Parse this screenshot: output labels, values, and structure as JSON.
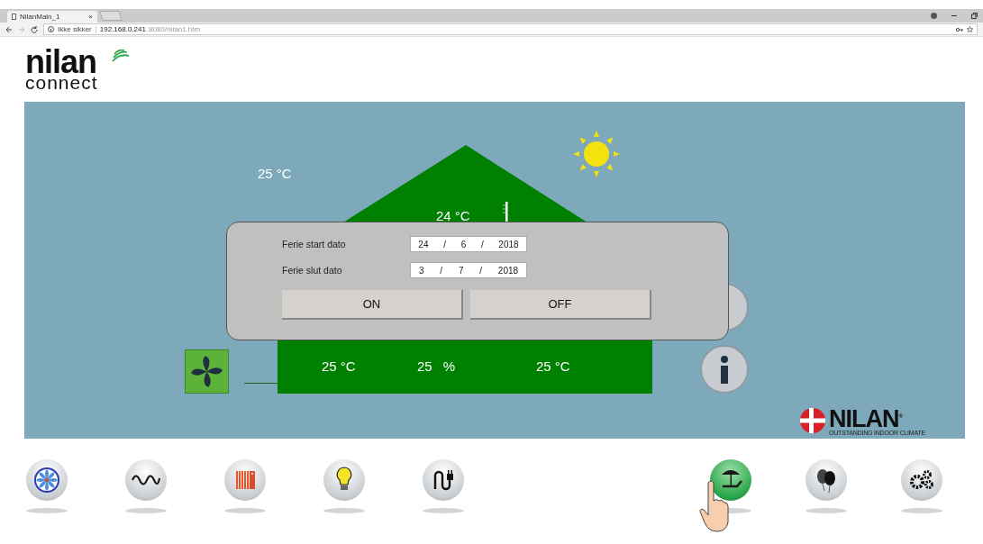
{
  "browser": {
    "tab_title": "NilanMain_1",
    "tab_close": "×",
    "security_label": "Ikke sikker",
    "url_host": "192.168.0.241",
    "url_rest": ":8080/nilan1.htm"
  },
  "logo": {
    "name": "nilan",
    "subtitle": "connect"
  },
  "house": {
    "outdoor_temp": "25 °C",
    "indoor_temp": "24 °C",
    "readings": [
      {
        "kind": "temp",
        "text": "25 °C"
      },
      {
        "kind": "humidity",
        "value": "25",
        "unit": "%"
      },
      {
        "kind": "temp",
        "text": "25 °C"
      }
    ]
  },
  "dialog": {
    "rows": [
      {
        "label": "Ferie start dato",
        "parts": [
          "24",
          "/",
          "6",
          "/",
          "2018"
        ]
      },
      {
        "label": "Ferie slut dato",
        "parts": [
          "3",
          "/",
          "7",
          "/",
          "2018"
        ]
      }
    ],
    "buttons": [
      "ON",
      "OFF"
    ]
  },
  "brand": {
    "name": "NILAN",
    "mark": "®",
    "tagline": "OUTSTANDING INDOOR CLIMATE"
  },
  "nav_left": [
    {
      "kind": "fan",
      "selected": false
    },
    {
      "kind": "wave",
      "selected": false
    },
    {
      "kind": "radiator",
      "selected": false
    },
    {
      "kind": "bulb",
      "selected": false
    },
    {
      "kind": "plug",
      "selected": false
    }
  ],
  "nav_right": [
    {
      "kind": "vacation",
      "selected": true
    },
    {
      "kind": "balloons",
      "selected": false
    },
    {
      "kind": "gears",
      "selected": false
    }
  ]
}
